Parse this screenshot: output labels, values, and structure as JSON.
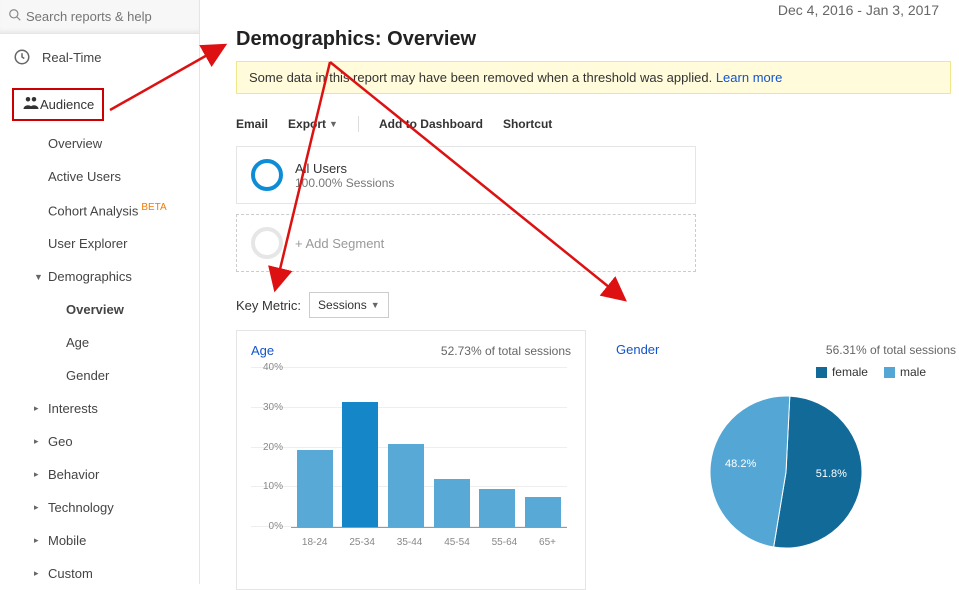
{
  "search": {
    "placeholder": "Search reports & help"
  },
  "nav": {
    "realtime": "Real-Time",
    "audience": "Audience"
  },
  "subnav": {
    "overview": "Overview",
    "active_users": "Active Users",
    "cohort": "Cohort Analysis",
    "beta": "BETA",
    "user_explorer": "User Explorer",
    "demographics": "Demographics",
    "demo_overview": "Overview",
    "demo_age": "Age",
    "demo_gender": "Gender",
    "interests": "Interests",
    "geo": "Geo",
    "behavior": "Behavior",
    "technology": "Technology",
    "mobile": "Mobile",
    "custom": "Custom"
  },
  "date_range": "Dec 4, 2016 - Jan 3, 2017",
  "page_title": "Demographics: Overview",
  "notice": {
    "text": "Some data in this report may have been removed when a threshold was applied. ",
    "link": "Learn more"
  },
  "toolbar": {
    "email": "Email",
    "export": "Export",
    "add_dashboard": "Add to Dashboard",
    "shortcut": "Shortcut"
  },
  "segments": {
    "all_users": "All Users",
    "all_users_sub": "100.00% Sessions",
    "add_segment": "+ Add Segment"
  },
  "key_metric": {
    "label": "Key Metric:",
    "value": "Sessions"
  },
  "age_panel": {
    "title": "Age",
    "subtitle": "52.73% of total sessions"
  },
  "gender_panel": {
    "title": "Gender",
    "subtitle": "56.31% of total sessions",
    "female": "female",
    "male": "male",
    "female_pct": "48.2%",
    "male_pct": "51.8%"
  },
  "chart_data": [
    {
      "type": "bar",
      "title": "Age",
      "subtitle": "52.73% of total sessions",
      "xlabel": "",
      "ylabel": "",
      "ylim": [
        0,
        40
      ],
      "yticks": [
        0,
        10,
        20,
        30,
        40
      ],
      "categories": [
        "18-24",
        "25-34",
        "35-44",
        "45-54",
        "55-64",
        "65+"
      ],
      "values": [
        19.5,
        31.5,
        21,
        12,
        9.5,
        7.5
      ]
    },
    {
      "type": "pie",
      "title": "Gender",
      "subtitle": "56.31% of total sessions",
      "series": [
        {
          "name": "female",
          "value": 48.2,
          "color": "#54a7d5"
        },
        {
          "name": "male",
          "value": 51.8,
          "color": "#126a98"
        }
      ]
    }
  ],
  "colors": {
    "bar_light": "#59a9d6",
    "bar_dark": "#1587c8",
    "pie_female": "#54a7d5",
    "pie_male": "#126a98"
  }
}
